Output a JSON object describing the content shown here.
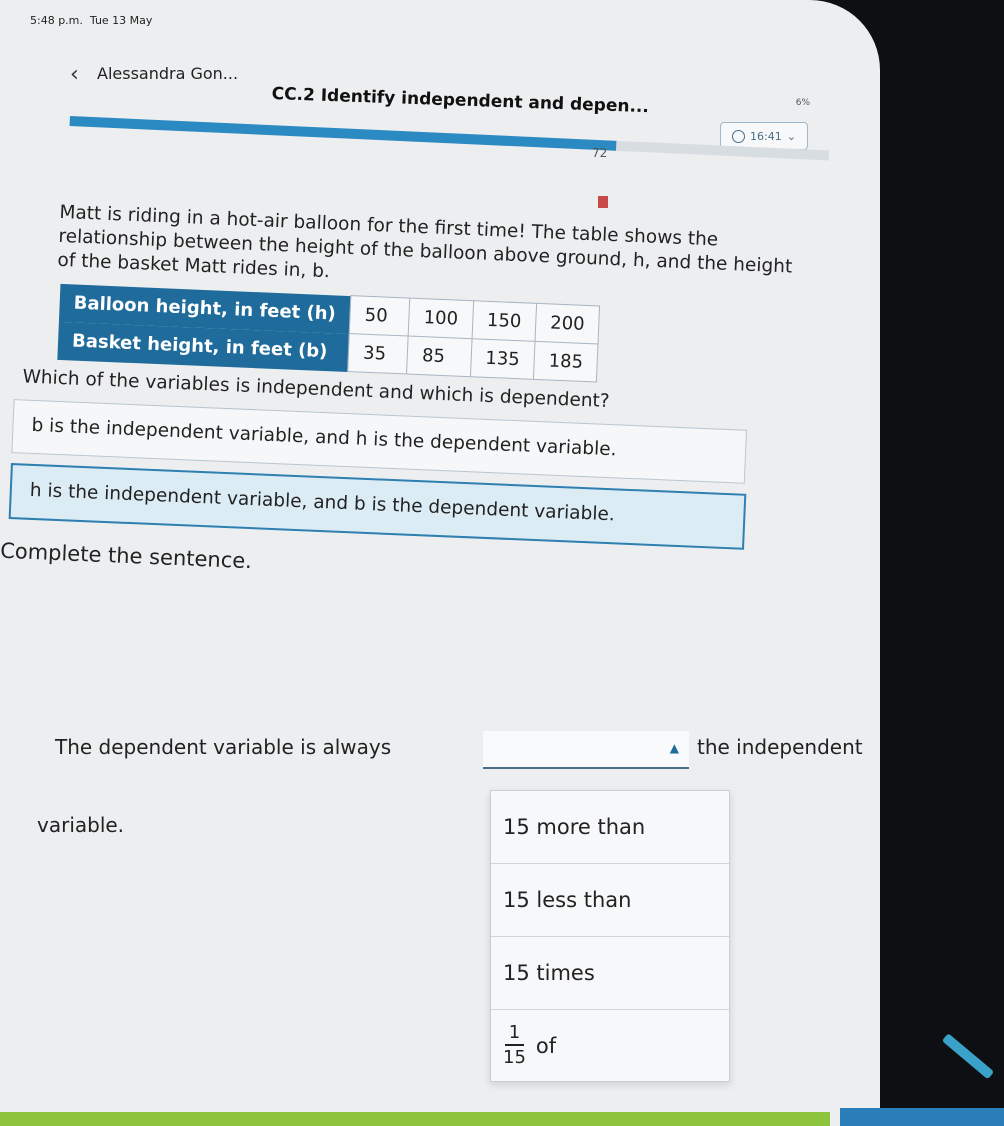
{
  "status_bar": {
    "time": "5:48 p.m.",
    "date": "Tue 13 May",
    "battery": "6%"
  },
  "header": {
    "back_icon": "chevron-left-icon",
    "user_name": "Alessandra Gon...",
    "skill_title": "CC.2 Identify independent and depen...",
    "timer": "16:41",
    "progress_value": "72",
    "progress_fraction": 0.72,
    "accent_color": "#2c8ac3"
  },
  "problem": {
    "prompt": "Matt is riding in a hot-air balloon for the first time! The table shows the relationship between the height of the balloon above ground, h, and the height of the basket Matt rides in, b.",
    "table": {
      "rows": [
        {
          "label": "Balloon height, in feet (h)",
          "values": [
            "50",
            "100",
            "150",
            "200"
          ]
        },
        {
          "label": "Basket height, in feet (b)",
          "values": [
            "35",
            "85",
            "135",
            "185"
          ]
        }
      ]
    },
    "question": "Which of the variables is independent and which is dependent?",
    "choices": [
      {
        "text": "b is the independent variable, and h is the dependent variable.",
        "selected": false
      },
      {
        "text": "h is the independent variable, and b is the dependent variable.",
        "selected": true
      }
    ]
  },
  "sentence_task": {
    "instruction": "Complete the sentence.",
    "before": "The dependent variable is always",
    "after": "the independent",
    "line2": "variable.",
    "dropdown_value": "",
    "options": [
      "15 more than",
      "15 less than",
      "15 times"
    ],
    "fraction_option": {
      "numerator": "1",
      "denominator": "15",
      "suffix": "of"
    }
  },
  "colors": {
    "table_header": "#1f6b9b",
    "bottom_bar_green": "#8cc43e",
    "bottom_bar_blue": "#2a7fb8"
  }
}
